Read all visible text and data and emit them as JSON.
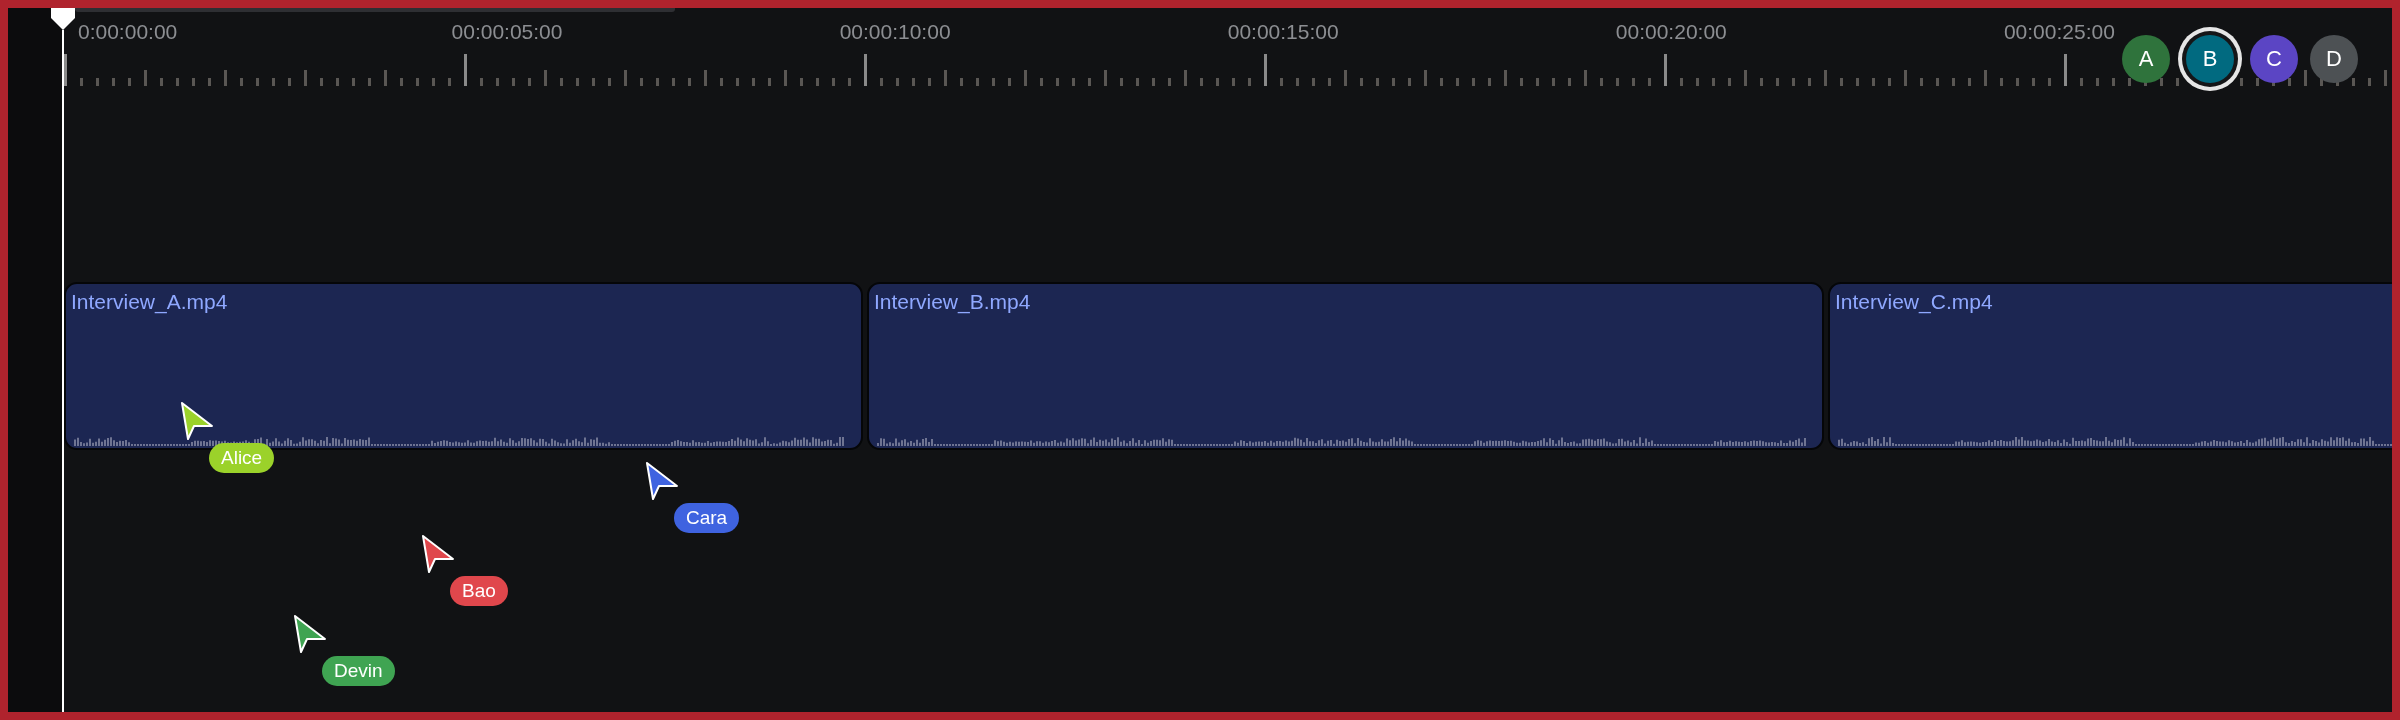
{
  "ruler": {
    "labels": [
      "0:00:00:00",
      "00:00:05:00",
      "00:00:10:00",
      "00:00:15:00",
      "00:00:20:00",
      "00:00:25:00"
    ]
  },
  "collaborators": [
    {
      "initial": "A",
      "color": "#2f733c",
      "selected": false
    },
    {
      "initial": "B",
      "color": "#016a80",
      "selected": true
    },
    {
      "initial": "C",
      "color": "#5b45c4",
      "selected": false
    },
    {
      "initial": "D",
      "color": "#4d5154",
      "selected": false
    }
  ],
  "clips": [
    {
      "name": "Interview_A.mp4"
    },
    {
      "name": "Interview_B.mp4"
    },
    {
      "name": "Interview_C.mp4"
    }
  ],
  "cursors": [
    {
      "name": "Alice",
      "color": "#9bd22a"
    },
    {
      "name": "Cara",
      "color": "#3f63e0"
    },
    {
      "name": "Bao",
      "color": "#e0474c"
    },
    {
      "name": "Devin",
      "color": "#3fa452"
    }
  ]
}
